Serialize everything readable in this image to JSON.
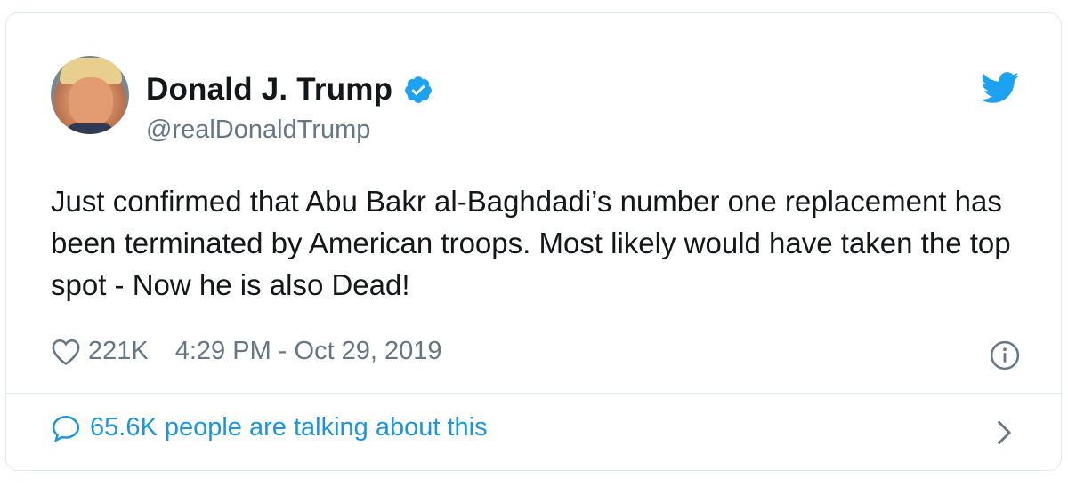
{
  "author": {
    "name": "Donald J. Trump",
    "handle": "@realDonaldTrump"
  },
  "tweet": {
    "text": "Just confirmed that Abu Bakr al-Baghdadi’s number one replacement has been terminated by American troops. Most likely would have taken the top spot - Now he is also Dead!",
    "likes": "221K",
    "timestamp": "4:29 PM - Oct 29, 2019"
  },
  "conversation": {
    "label": "65.6K people are talking about this"
  },
  "icons": {
    "verified": "verified-badge-icon",
    "brand": "twitter-bird-icon",
    "like": "heart-icon",
    "info": "info-icon",
    "reply": "speech-bubble-icon",
    "more": "chevron-right-icon"
  },
  "colors": {
    "brand": "#1da1f2",
    "link": "#1b95e0",
    "text": "#14171a",
    "muted": "#657786",
    "border": "#e1e8ed"
  }
}
